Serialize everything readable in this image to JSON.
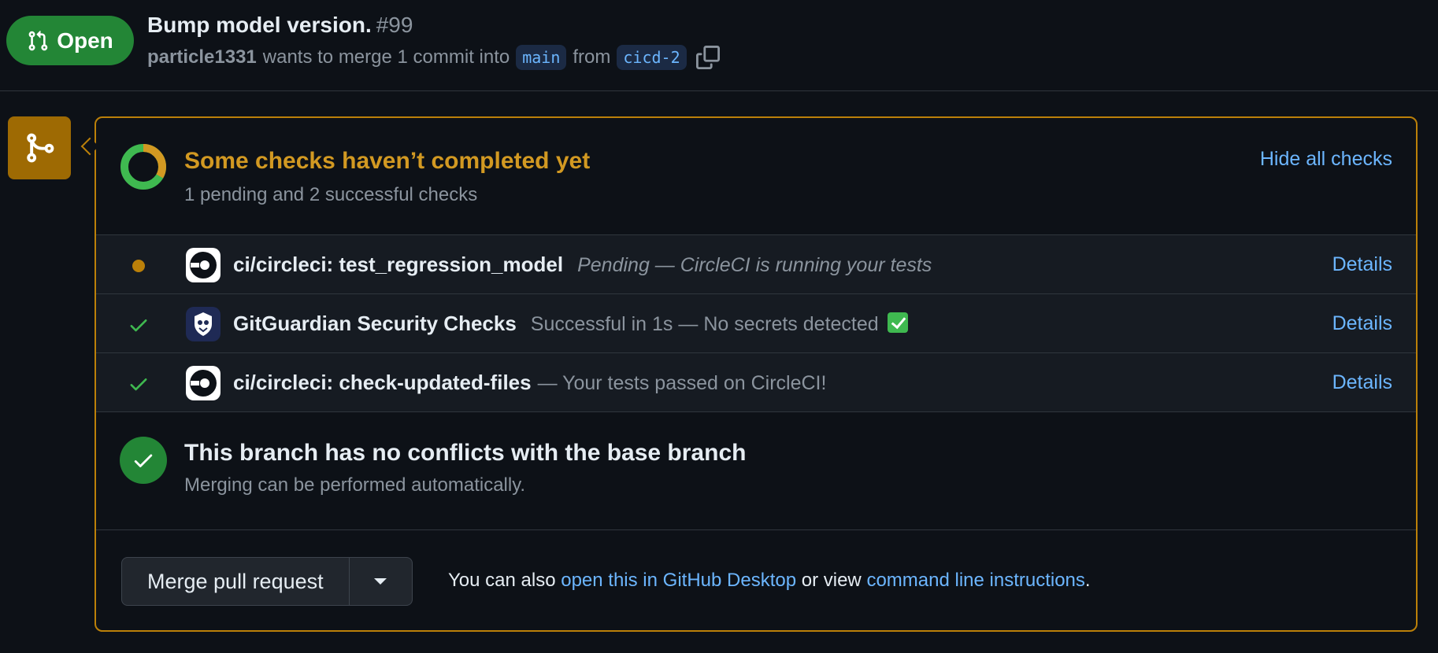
{
  "pr": {
    "state": "Open",
    "title": "Bump model version.",
    "number": "#99",
    "author": "particle1331",
    "merge_text": "wants to merge 1 commit into",
    "base_branch": "main",
    "from_text": "from",
    "head_branch": "cicd-2"
  },
  "checks": {
    "title": "Some checks haven’t completed yet",
    "summary": "1 pending and 2 successful checks",
    "hide_label": "Hide all checks",
    "pending_fraction": 0.333,
    "items": [
      {
        "status": "pending",
        "name": "ci/circleci: test_regression_model",
        "description": "Pending — CircleCI is running your tests",
        "details": "Details"
      },
      {
        "status": "success",
        "name": "GitGuardian Security Checks",
        "description": "Successful in 1s — No secrets detected",
        "details": "Details"
      },
      {
        "status": "success",
        "name": "ci/circleci: check-updated-files",
        "description": "— Your tests passed on CircleCI!",
        "details": "Details"
      }
    ]
  },
  "conflicts": {
    "title": "This branch has no conflicts with the base branch",
    "subtitle": "Merging can be performed automatically."
  },
  "merge": {
    "button_label": "Merge pull request",
    "hint_prefix": "You can also",
    "desktop_link": "open this in GitHub Desktop",
    "hint_middle": "or view",
    "cli_link": "command line instructions",
    "hint_suffix": "."
  },
  "colors": {
    "open_green": "#238636",
    "pending_amber": "#d29922",
    "success_green": "#3fb950",
    "link_blue": "#6cb6ff"
  }
}
